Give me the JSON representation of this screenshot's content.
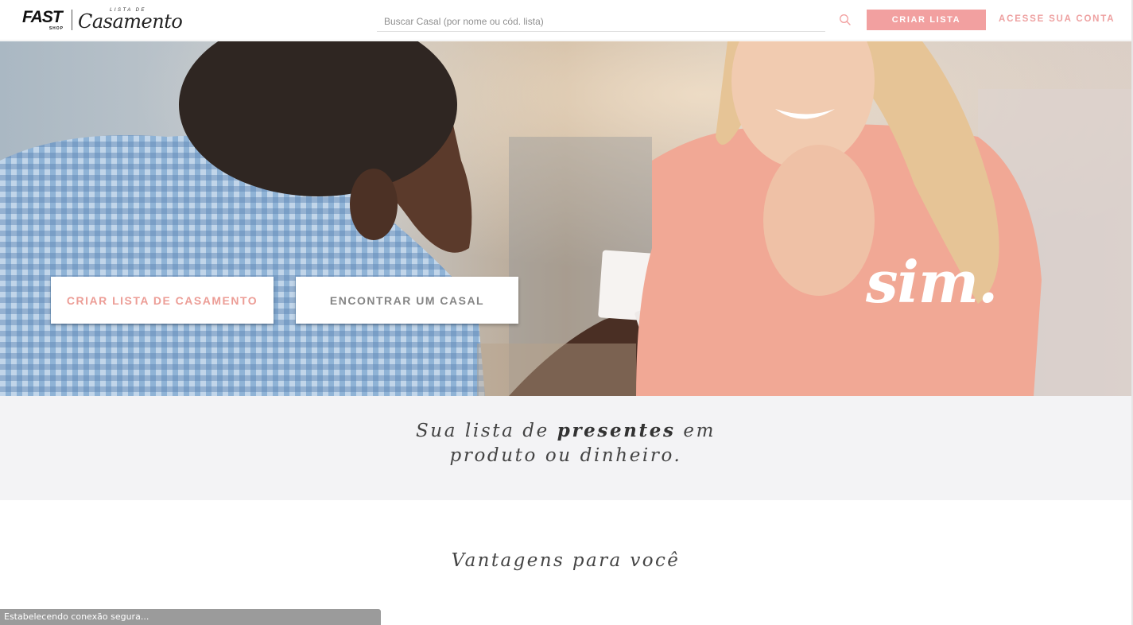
{
  "brand": {
    "fast": "FAST",
    "shop": "SHOP",
    "lista_de": "LISTA DE",
    "casamento": "Casamento",
    "accent_color": "#f2a0a0"
  },
  "header": {
    "search_placeholder": "Buscar Casal (por nome ou cód. lista)",
    "search_icon": "search-icon",
    "criar_lista_label": "CRIAR LISTA",
    "acesse_conta_label": "ACESSE SUA CONTA"
  },
  "hero": {
    "criar_lista_casamento_label": "CRIAR LISTA DE CASAMENTO",
    "encontrar_casal_label": "ENCONTRAR UM CASAL",
    "slogan": "sim."
  },
  "tagline": {
    "line1_pre": "Sua lista de ",
    "line1_bold": "presentes",
    "line1_post": " em",
    "line2": "produto ou dinheiro."
  },
  "advantages": {
    "title": "Vantagens para você"
  },
  "status_bar": {
    "text": "Estabelecendo conexão segura..."
  }
}
